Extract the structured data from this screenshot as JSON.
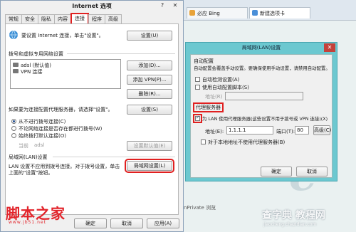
{
  "browser": {
    "tab1": "必应 Bing",
    "tab2": "新建选项卡",
    "status_text": "nPrivate 浏览"
  },
  "options_window": {
    "title": "Internet 选项",
    "help_glyph": "?",
    "close_glyph": "✕",
    "tabs": [
      {
        "label": "常规"
      },
      {
        "label": "安全"
      },
      {
        "label": "隐私"
      },
      {
        "label": "内容"
      },
      {
        "label": "连接",
        "active": true
      },
      {
        "label": "程序"
      },
      {
        "label": "高级"
      }
    ],
    "setup_text": "要设置 Internet 连接，单击\"设置\"。",
    "setup_button": "设置(U)",
    "dialup_title": "拨号和虚拟专用网络设置",
    "connections": [
      "adsl (默认值)",
      "VPN 连接"
    ],
    "add_button": "添加(D)...",
    "add_vpn_button": "添加 VPN(P)...",
    "delete_button": "删除(R)...",
    "proxy_note": "如果要为连接配置代理服务器，请选择\"设置\"。",
    "settings_button": "设置(S)",
    "radio_never": "从不进行拨号连接(C)",
    "radio_when_absent": "不论网络连接是否存在都进行拨号(W)",
    "radio_always": "始终拨打默认连接(O)",
    "current_label": "当前",
    "current_value": "adsl",
    "set_default_button": "设置默认值(E)",
    "lan_title": "局域网(LAN)设置",
    "lan_text_1": "LAN 设置不应用到拨号连接。对于拨号设置，单击",
    "lan_text_2": "上面的\"设置\"按钮。",
    "lan_button": "局域网设置(L)",
    "ok_button": "确定",
    "cancel_button": "取消",
    "apply_button": "应用(A)"
  },
  "lan_dialog": {
    "title": "局域网(LAN)设置",
    "close_glyph": "✕",
    "auto_title": "自动配置",
    "auto_desc": "自动配置会覆盖手动设置。要确保使用手动设置，请禁用自动配置。",
    "auto_detect": "自动检测设置(A)",
    "auto_script": "使用自动配置脚本(S)",
    "address_label": "地址(R)",
    "proxy_title": "代理服务器",
    "use_proxy": "为 LAN 使用代理服务器(这些设置不用于拨号或 VPN 连接)(X)",
    "proxy_address_label": "地址(E):",
    "proxy_address_value": "1.1.1.1",
    "port_label": "端口(T):",
    "port_value": "80",
    "advanced_button": "高级(C)",
    "bypass_local": "对于本地地址不使用代理服务器(B)",
    "ok_button": "确定",
    "cancel_button": "取消"
  },
  "watermarks": {
    "left_title": "脚本之家",
    "left_url": "www.jb51.net",
    "right_title": "查字典 教程网",
    "right_url": "jiaocheng.chazidian.com"
  },
  "colors": {
    "highlight_red": "#e02020",
    "dialog_frame": "#6cc8d0"
  }
}
